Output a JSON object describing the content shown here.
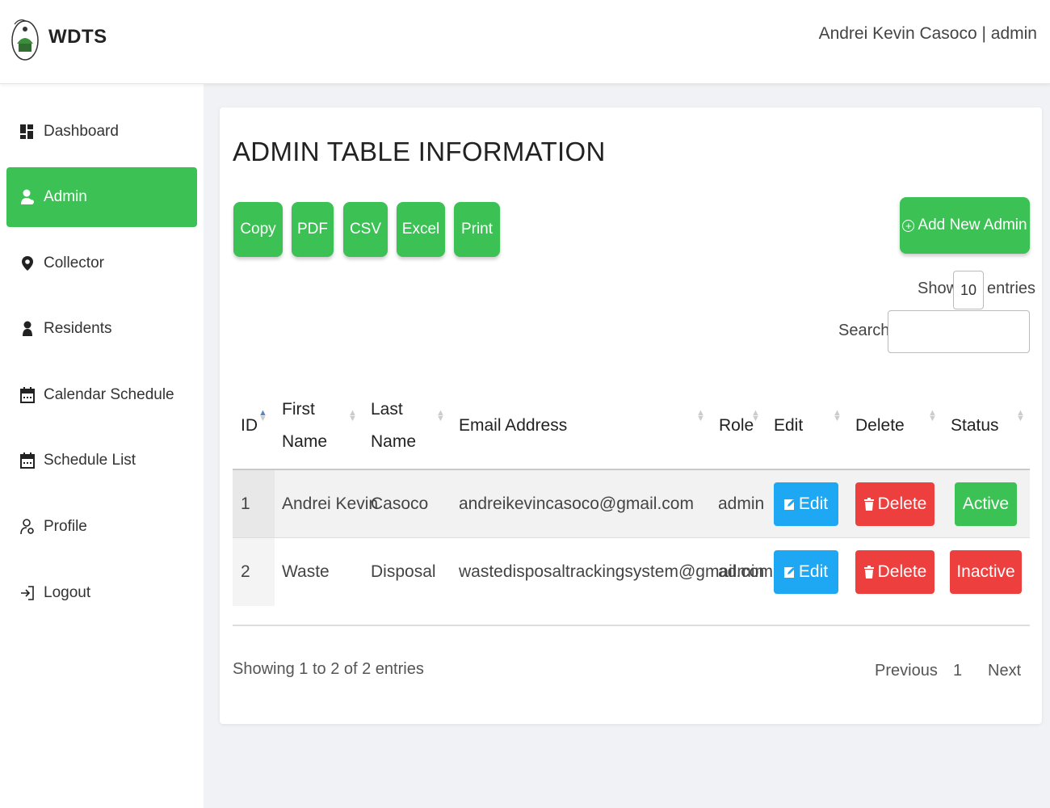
{
  "header": {
    "app_title": "WDTS",
    "user_info": "Andrei Kevin Casoco | admin"
  },
  "sidebar": {
    "items": [
      {
        "label": "Dashboard",
        "icon": "dashboard-icon"
      },
      {
        "label": "Admin",
        "icon": "user-icon"
      },
      {
        "label": "Collector",
        "icon": "map-pin-icon"
      },
      {
        "label": "Residents",
        "icon": "person-icon"
      },
      {
        "label": "Calendar Schedule",
        "icon": "calendar-icon"
      },
      {
        "label": "Schedule List",
        "icon": "calendar-icon"
      },
      {
        "label": "Profile",
        "icon": "user-gear-icon"
      },
      {
        "label": "Logout",
        "icon": "logout-icon"
      }
    ],
    "active_index": 1
  },
  "main": {
    "title": "ADMIN TABLE INFORMATION",
    "export_buttons": [
      "Copy",
      "PDF",
      "CSV",
      "Excel",
      "Print"
    ],
    "add_button": "Add New Admin",
    "length": {
      "show_label": "Show",
      "value": "10",
      "entries_label": "entries"
    },
    "search": {
      "label": "Search:",
      "value": ""
    },
    "table": {
      "columns": [
        "ID",
        "First Name",
        "Last Name",
        "Email Address",
        "Role",
        "Edit",
        "Delete",
        "Status"
      ],
      "column_lines": {
        "first_name": [
          "First",
          "Name"
        ],
        "last_name": [
          "Last",
          "Name"
        ]
      },
      "rows": [
        {
          "id": "1",
          "first_name": "Andrei Kevin",
          "last_name": "Casoco",
          "email": "andreikevincasoco@gmail.com",
          "role": "admin",
          "edit": "Edit",
          "delete": "Delete",
          "status": "Active"
        },
        {
          "id": "2",
          "first_name": "Waste",
          "last_name": "Disposal",
          "email": "wastedisposaltrackingsystem@gmail.com",
          "role": "admin",
          "edit": "Edit",
          "delete": "Delete",
          "status": "Inactive"
        }
      ]
    },
    "info": "Showing 1 to 2 of 2 entries",
    "pagination": {
      "previous": "Previous",
      "current": "1",
      "next": "Next"
    }
  },
  "colors": {
    "accent_green": "#3cc155",
    "edit_blue": "#1ea7f2",
    "danger_red": "#ee3f3f"
  }
}
